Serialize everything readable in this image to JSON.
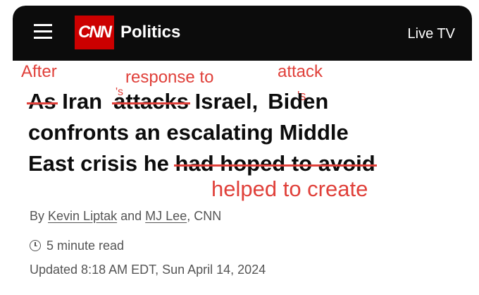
{
  "topbar": {
    "logo_text": "CNN",
    "section": "Politics",
    "live_tv": "Live TV",
    "brand_color": "#cc0000"
  },
  "headline": {
    "line1": {
      "struck_as": "As",
      "iran": "Iran",
      "struck_attacks": "attacks",
      "israel": "Israel,",
      "biden": "Biden"
    },
    "line2": "confronts an escalating Middle",
    "line3": {
      "prefix": "East crisis he",
      "struck": "had hoped to avoid"
    }
  },
  "annotations": {
    "color": "#e0403a",
    "after": "After",
    "response_to": "response to",
    "attack": "attack",
    "possessive_1": "'s",
    "possessive_2": "'s",
    "helped_to_create": "helped to create"
  },
  "byline": {
    "by": "By",
    "author1": "Kevin Liptak",
    "and": "and",
    "author2": "MJ Lee",
    "outlet": ", CNN"
  },
  "read_time": "5 minute read",
  "updated": "Updated 8:18 AM EDT, Sun April 14, 2024"
}
